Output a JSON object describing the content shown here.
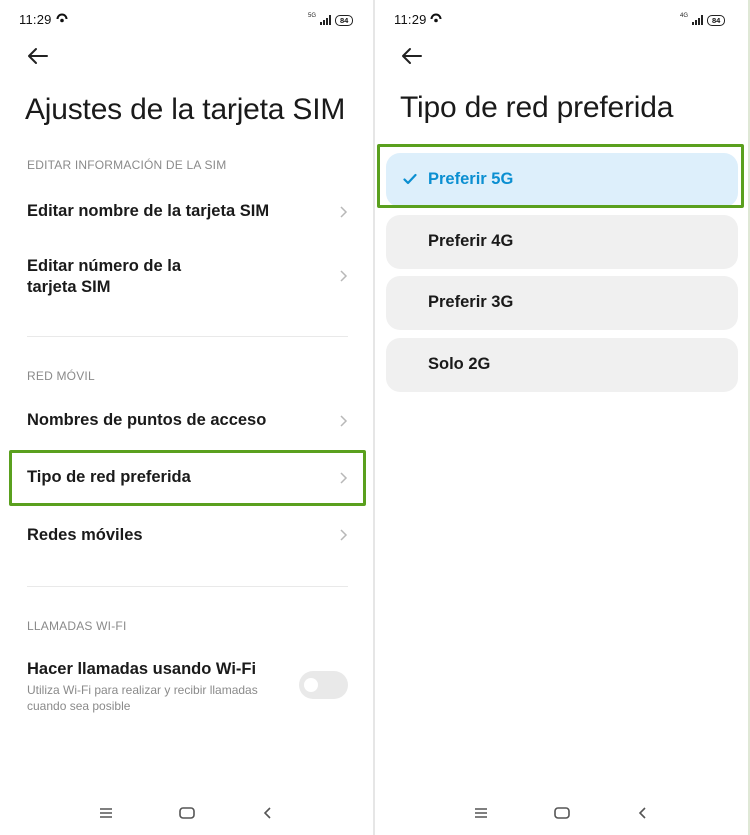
{
  "left": {
    "status": {
      "time": "11:29",
      "network": "5G",
      "battery": "84"
    },
    "title": "Ajustes de la tarjeta SIM",
    "sections": {
      "sim_info": "EDITAR INFORMACIÓN DE LA SIM",
      "mobile_network": "RED MÓVIL",
      "wifi_calls": "LLAMADAS WI-FI"
    },
    "items": {
      "edit_name": "Editar nombre de la tarjeta SIM",
      "edit_number_line1": "Editar número de la",
      "edit_number_line2": "tarjeta SIM",
      "apn": "Nombres de puntos de acceso",
      "preferred_network": "Tipo de red preferida",
      "mobile_networks": "Redes móviles",
      "wifi_calling_title": "Hacer llamadas usando Wi-Fi",
      "wifi_calling_desc_line1": "Utiliza Wi-Fi para realizar y recibir llamadas",
      "wifi_calling_desc_line2": "cuando sea posible"
    },
    "wifi_calling_enabled": false
  },
  "right": {
    "status": {
      "time": "11:29",
      "network": "4G",
      "battery": "84"
    },
    "title": "Tipo de red preferida",
    "options": [
      {
        "label": "Preferir 5G",
        "selected": true
      },
      {
        "label": "Preferir 4G",
        "selected": false
      },
      {
        "label": "Preferir 3G",
        "selected": false
      },
      {
        "label": "Solo 2G",
        "selected": false
      }
    ]
  },
  "icons": {
    "back": "arrow-left-icon",
    "chevron": "chevron-right-icon",
    "check": "check-icon",
    "nav_menu": "menu-icon",
    "nav_home": "home-icon",
    "nav_back": "back-icon"
  },
  "colors": {
    "highlight": "#5aa01e",
    "selected_text": "#0b8fd1",
    "selected_bg": "#ddeffb",
    "option_bg": "#f0f0f0"
  }
}
